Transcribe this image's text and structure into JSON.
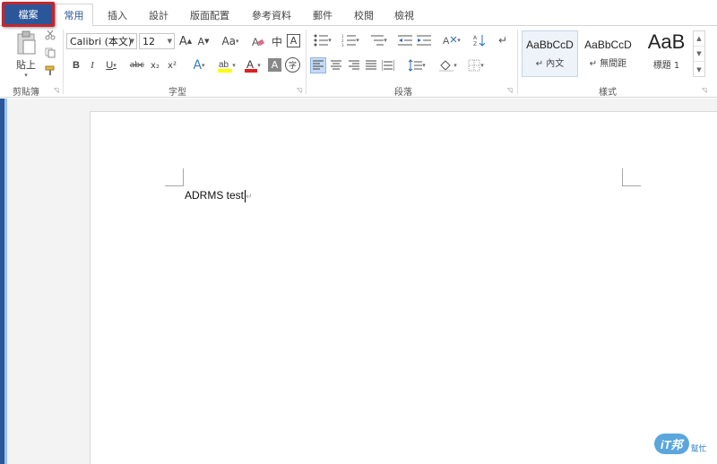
{
  "tabs": {
    "file": "檔案",
    "items": [
      "常用",
      "插入",
      "設計",
      "版面配置",
      "參考資料",
      "郵件",
      "校閱",
      "檢視"
    ],
    "active_index": 0
  },
  "clipboard": {
    "paste_label": "貼上",
    "group_label": "剪貼簿"
  },
  "font": {
    "name": "Calibri (本文)",
    "size": "12",
    "group_label": "字型",
    "buttons": {
      "grow": "A",
      "shrink": "A",
      "case": "Aa",
      "phonetic": "中",
      "border_char": "A",
      "bold": "B",
      "italic": "I",
      "underline": "U",
      "strike": "abc",
      "sub": "x₂",
      "super": "x²",
      "effects": "A",
      "font_color": "A",
      "shade_char": "A",
      "enclose": "字"
    },
    "colors": {
      "highlight": "#ffff00",
      "font_color": "#e02020"
    }
  },
  "paragraph": {
    "group_label": "段落"
  },
  "styles": {
    "group_label": "樣式",
    "items": [
      {
        "sample": "AaBbCcD",
        "name": "↵ 內文"
      },
      {
        "sample": "AaBbCcD",
        "name": "↵ 無間距"
      },
      {
        "sample": "AaB",
        "name": "標題 1"
      }
    ]
  },
  "document": {
    "text": "ADRMS test"
  },
  "watermark": {
    "logo": "iT邦",
    "sub": "幫忙"
  },
  "colors": {
    "accent": "#2b579a",
    "file_border": "#c4262e"
  }
}
